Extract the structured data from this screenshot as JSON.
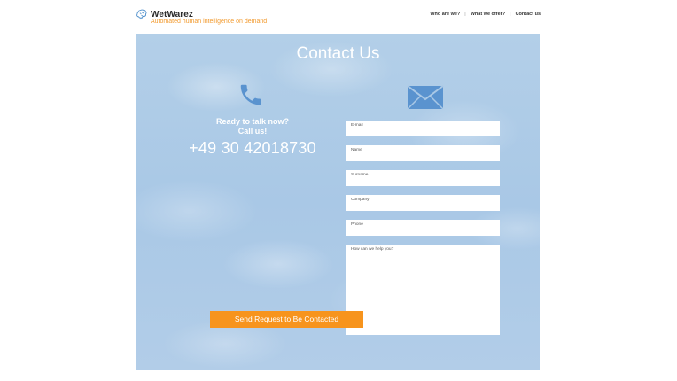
{
  "header": {
    "brand_name": "WetWarez",
    "tagline": "Automated human intelligence on demand",
    "nav": [
      {
        "label": "Who are we?"
      },
      {
        "label": "What we offer?"
      },
      {
        "label": "Contact us"
      }
    ],
    "separator": "|"
  },
  "hero": {
    "title": "Contact Us",
    "call_prompt_line1": "Ready to talk now?",
    "call_prompt_line2": "Call us!",
    "phone_number": "+49 30 42018730"
  },
  "form": {
    "email": {
      "placeholder": "E-mail",
      "value": ""
    },
    "name": {
      "placeholder": "Name",
      "value": ""
    },
    "surname": {
      "placeholder": "Surname",
      "value": ""
    },
    "company": {
      "placeholder": "Company",
      "value": ""
    },
    "phone": {
      "placeholder": "Phone",
      "value": ""
    },
    "message": {
      "placeholder": "How can we help you?",
      "value": ""
    },
    "submit_label": "Send Request to Be Contacted"
  },
  "icons": {
    "logo": "brain-icon",
    "phone": "phone-icon",
    "mail": "envelope-icon"
  },
  "colors": {
    "accent": "#f7941d",
    "tagline": "#f29a2e",
    "icon_blue": "#5a93cf",
    "sky": "#aac8e6"
  }
}
